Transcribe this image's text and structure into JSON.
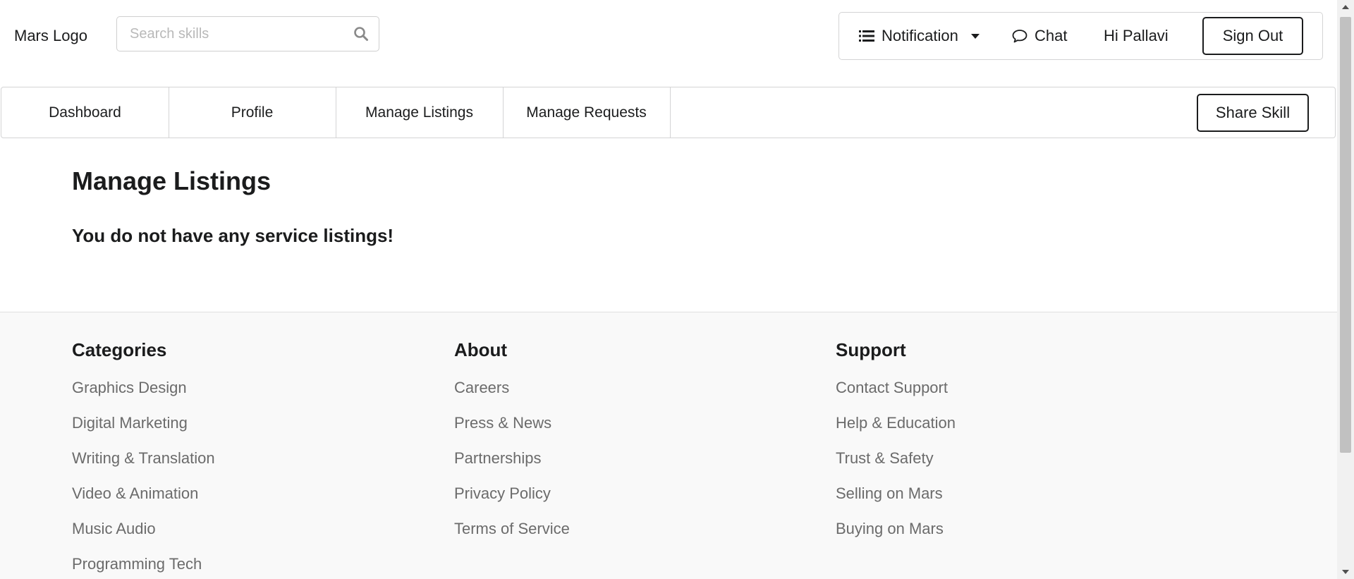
{
  "header": {
    "logo_text": "Mars Logo",
    "search": {
      "placeholder": "Search skills",
      "value": ""
    },
    "menu": {
      "notification_label": "Notification",
      "chat_label": "Chat",
      "greeting": "Hi Pallavi",
      "signout_label": "Sign Out"
    }
  },
  "nav": {
    "tabs": [
      {
        "label": "Dashboard"
      },
      {
        "label": "Profile"
      },
      {
        "label": "Manage Listings"
      },
      {
        "label": "Manage Requests"
      }
    ],
    "share_label": "Share Skill"
  },
  "main": {
    "title": "Manage Listings",
    "empty_message": "You do not have any service listings!"
  },
  "footer": {
    "columns": [
      {
        "heading": "Categories",
        "links": [
          "Graphics Design",
          "Digital Marketing",
          "Writing & Translation",
          "Video & Animation",
          "Music Audio",
          "Programming Tech"
        ]
      },
      {
        "heading": "About",
        "links": [
          "Careers",
          "Press & News",
          "Partnerships",
          "Privacy Policy",
          "Terms of Service"
        ]
      },
      {
        "heading": "Support",
        "links": [
          "Contact Support",
          "Help & Education",
          "Trust & Safety",
          "Selling on Mars",
          "Buying on Mars"
        ]
      }
    ]
  },
  "icons": {
    "search": "search-icon",
    "notification": "list-icon",
    "notification_caret": "caret-down-icon",
    "chat": "chat-bubble-icon"
  },
  "colors": {
    "text": "#1b1c1d",
    "footer_link": "#6b6b6b",
    "footer_bg": "#f9f9f9",
    "border": "#d4d4d5"
  }
}
